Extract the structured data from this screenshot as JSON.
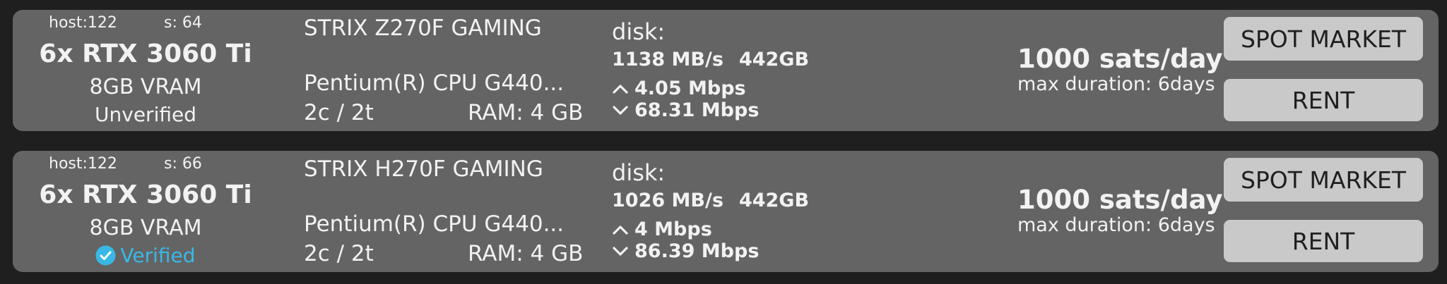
{
  "offers": [
    {
      "host": "host:122",
      "score": "s: 64",
      "gpu": "6x RTX 3060 Ti",
      "vram": "8GB VRAM",
      "verification": "Unverified",
      "verified": false,
      "motherboard": "STRIX Z270F GAMING",
      "cpu": "Pentium(R) CPU G440...",
      "cores": "2c / 2t",
      "ram": "RAM: 4 GB",
      "disk_label": "disk:",
      "disk_speed": "1138 MB/s",
      "disk_size": "442GB",
      "upload": "4.05 Mbps",
      "download": "68.31 Mbps",
      "price": "1000 sats/day",
      "max_duration": "max duration: 6days",
      "spot_button": "SPOT MARKET",
      "rent_button": "RENT"
    },
    {
      "host": "host:122",
      "score": "s: 66",
      "gpu": "6x RTX 3060 Ti",
      "vram": "8GB VRAM",
      "verification": "Verified",
      "verified": true,
      "motherboard": "STRIX H270F GAMING",
      "cpu": "Pentium(R) CPU G440...",
      "cores": "2c / 2t",
      "ram": "RAM: 4 GB",
      "disk_label": "disk:",
      "disk_speed": "1026 MB/s",
      "disk_size": "442GB",
      "upload": "4 Mbps",
      "download": "86.39 Mbps",
      "price": "1000 sats/day",
      "max_duration": "max duration: 6days",
      "spot_button": "SPOT MARKET",
      "rent_button": "RENT"
    }
  ],
  "colors": {
    "background": "#1f1f1f",
    "card": "#646464",
    "button": "#c9c9c9",
    "verified": "#39b8e6"
  },
  "icons": {
    "upload": "chevron-up-icon",
    "download": "chevron-down-icon",
    "verified": "check-circle-icon"
  }
}
